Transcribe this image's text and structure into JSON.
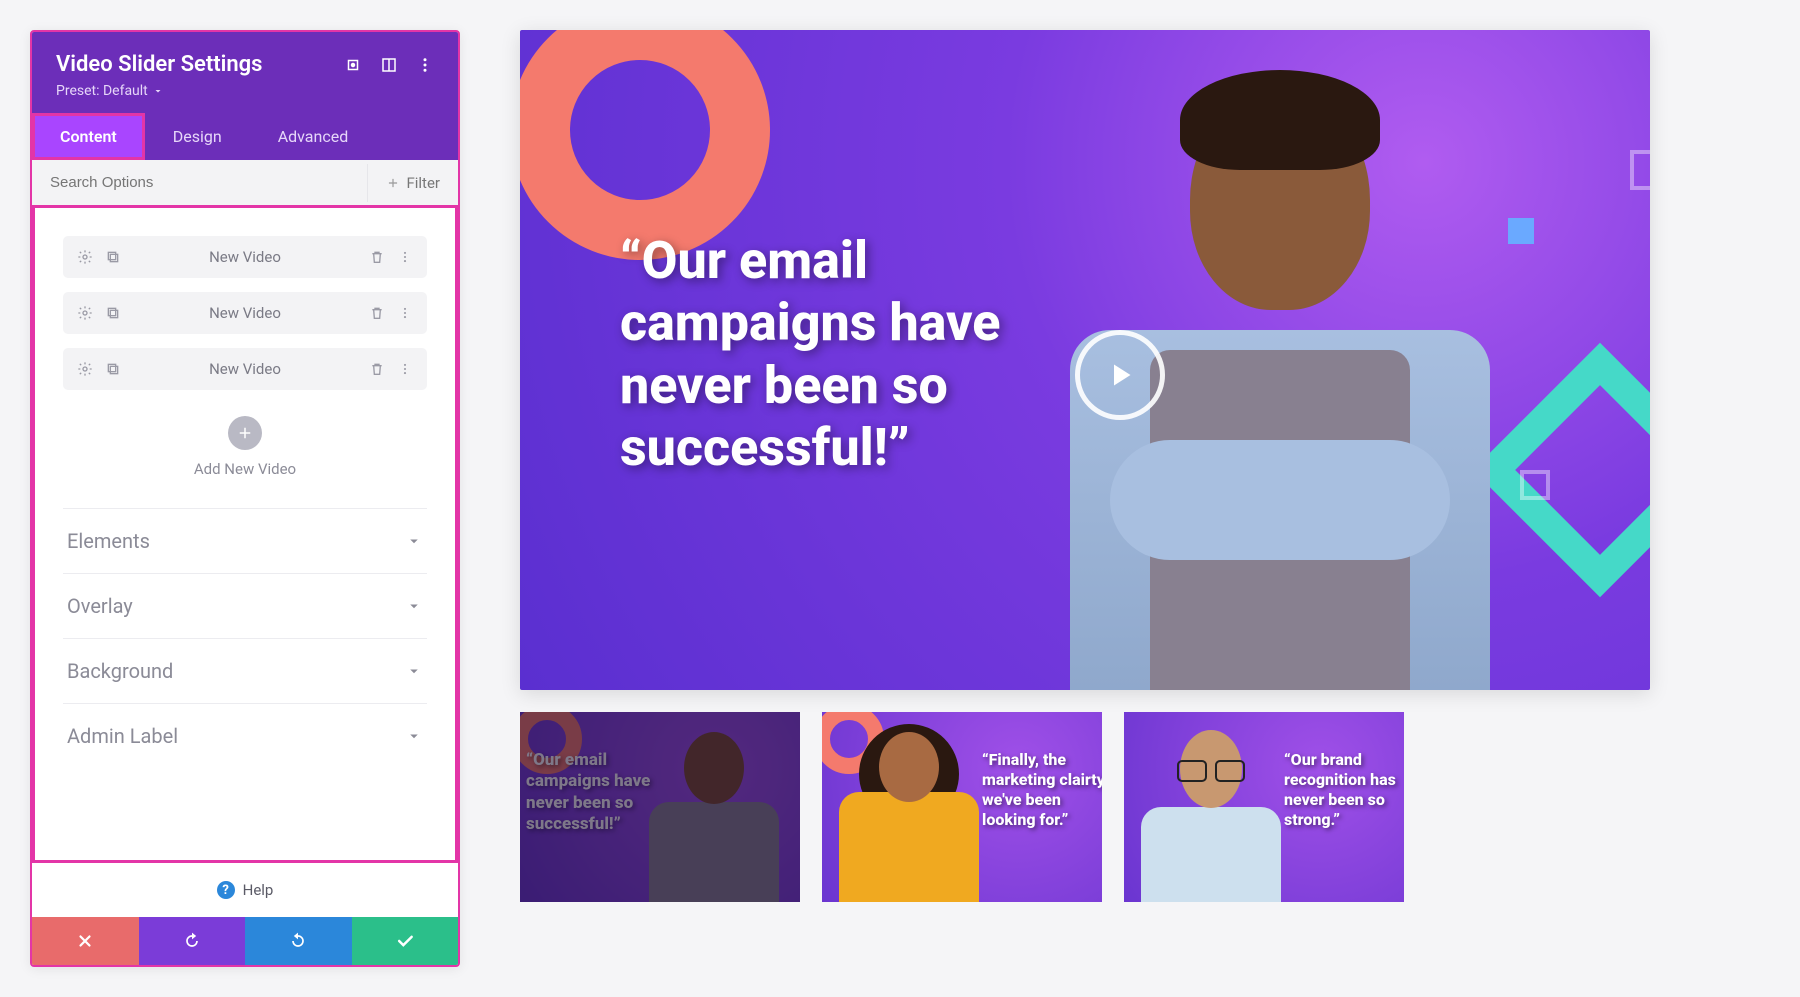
{
  "panel": {
    "title": "Video Slider Settings",
    "preset_label": "Preset: Default",
    "tabs": {
      "content": "Content",
      "design": "Design",
      "advanced": "Advanced"
    },
    "search_placeholder": "Search Options",
    "filter_label": "Filter",
    "videos": [
      {
        "label": "New Video"
      },
      {
        "label": "New Video"
      },
      {
        "label": "New Video"
      }
    ],
    "add_label": "Add New Video",
    "sections": {
      "elements": "Elements",
      "overlay": "Overlay",
      "background": "Background",
      "admin_label": "Admin Label"
    },
    "help": "Help"
  },
  "preview": {
    "main_quote": "“Our email campaigns have never been so successful!”",
    "thumbs": [
      {
        "quote": "“Our email campaigns have never been so successful!”"
      },
      {
        "quote": "“Finally, the marketing clairty we've been looking for.”"
      },
      {
        "quote": "“Our brand recognition has never been so strong.”"
      }
    ]
  }
}
